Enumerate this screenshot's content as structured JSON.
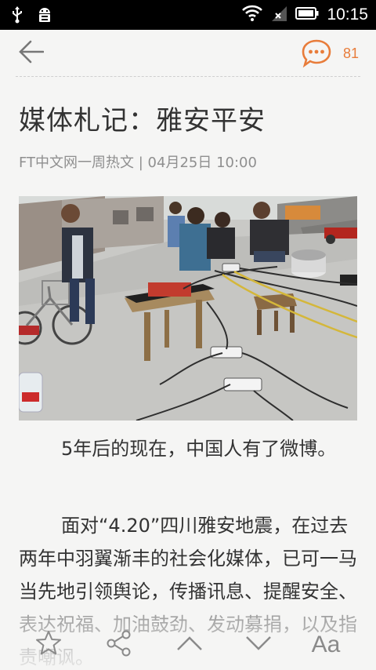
{
  "status_bar": {
    "time": "10:15",
    "icons": [
      "usb-icon",
      "android-debug-icon",
      "wifi-icon",
      "signal-icon",
      "battery-icon"
    ]
  },
  "header": {
    "back_icon": "arrow-left-icon",
    "comment_icon": "comment-bubble-icon",
    "comment_count": "81",
    "accent_color": "#e87c3a"
  },
  "article": {
    "title": "媒体札记：雅安平安",
    "meta": "FT中文网一周热文 | 04月25日 10:00",
    "paragraphs": [
      "5年后的现在，中国人有了微博。",
      "面对“4.20”四川雅安地震，在过去两年中羽翼渐丰的社会化媒体，已可一马当先地引领舆论，传播讯息、提醒安全、表达祝福、加油鼓劲、发动募捐，以及指责嘲讽。"
    ]
  },
  "bottom_bar": {
    "icons": [
      "star-icon",
      "share-icon",
      "chevron-up-icon",
      "chevron-down-icon"
    ],
    "font_label": "Aa"
  }
}
